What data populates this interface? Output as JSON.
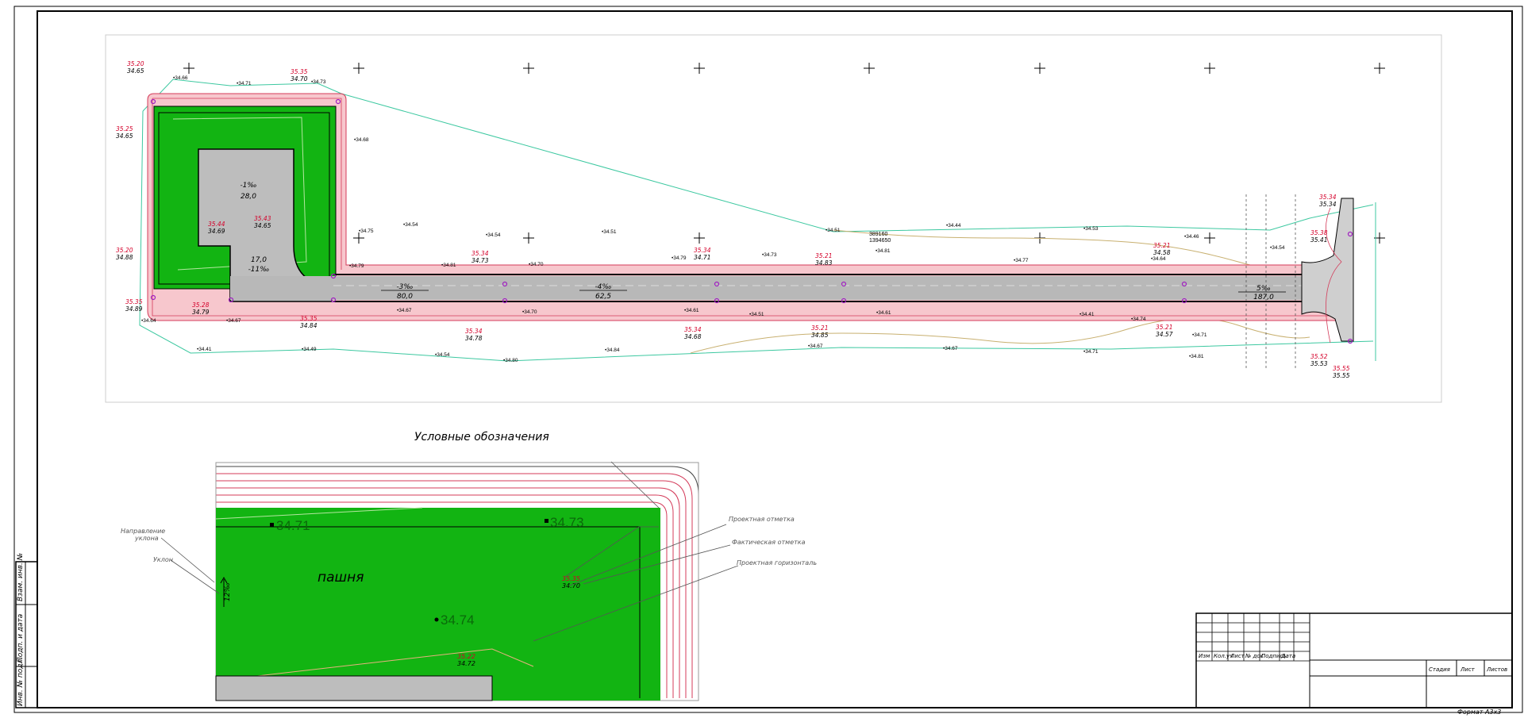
{
  "legend_title": "Условные обозначения",
  "legend": {
    "field_label": "пашня",
    "elev_1": "34.71",
    "elev_2": "34.73",
    "elev_3": "34.74",
    "slope_value": "12‰",
    "proj_mark_red": "35.35",
    "proj_mark_black": "34.70",
    "proj_mark2_red": "35.22",
    "proj_mark2_black": "34.72",
    "label_direction_1": "Направление",
    "label_direction_2": "уклона",
    "label_slope": "Уклон",
    "label_project_mark": "Проектная отметка",
    "label_actual_mark": "Фактическая отметка",
    "label_project_contour": "Проектная горизонталь"
  },
  "stamp": {
    "col_izm": "Изм",
    "col_koluch": "Кол.уч",
    "col_list": "Лист",
    "col_ndok": "№ док",
    "col_podpis": "Подпись",
    "col_data": "Дата",
    "col_stadiya": "Стадия",
    "col_list2": "Лист",
    "col_listov": "Листов",
    "format": "Формат А3х3"
  },
  "side_stamp": {
    "inv_podl": "Инв. № подл.",
    "podp_data": "Подп. и дата",
    "vzam_inv": "Взам. инв. №"
  },
  "plan": {
    "segment_1_slope": "-3‰",
    "segment_1_len": "80,0",
    "segment_2_slope": "-4‰",
    "segment_2_len": "62,5",
    "segment_3_slope": "5‰",
    "segment_3_len": "187,0",
    "pad_slope": "-1‰",
    "pad_len": "28,0",
    "pad_side_slope": "17,0",
    "pad_side_len": "-11‰",
    "coord_1": "389160",
    "coord_2": "1394650",
    "points": [
      {
        "red": "35.20",
        "black": "34.65"
      },
      {
        "red": "35.35",
        "black": "34.70"
      },
      {
        "red": "35.25",
        "black": "34.65"
      },
      {
        "red": "35.20",
        "black": "34.88"
      },
      {
        "red": "35.35",
        "black": "34.89"
      },
      {
        "red": "35.28",
        "black": "34.79"
      },
      {
        "red": "35.35",
        "black": "34.84"
      },
      {
        "red": "35.44",
        "black": "34.69"
      },
      {
        "red": "35.43",
        "black": "34.65"
      },
      {
        "red": "35.34",
        "black": "34.73"
      },
      {
        "red": "35.34",
        "black": "34.78"
      },
      {
        "red": "35.34",
        "black": "34.71"
      },
      {
        "red": "35.34",
        "black": "34.68"
      },
      {
        "red": "35.21",
        "black": "34.83"
      },
      {
        "red": "35.21",
        "black": "34.85"
      },
      {
        "red": "35.21",
        "black": "34.58"
      },
      {
        "red": "35.21",
        "black": "34.57"
      },
      {
        "red": "35.34",
        "black": "35.34"
      },
      {
        "red": "35.38",
        "black": "35.41"
      },
      {
        "red": "35.52",
        "black": "35.53"
      },
      {
        "red": "35.55",
        "black": "35.55"
      }
    ],
    "spot_elevations": [
      "34.66",
      "34.71",
      "34.73",
      "34.68",
      "34.75",
      "34.54",
      "34.54",
      "34.51",
      "34.51",
      "34.44",
      "34.53",
      "34.46",
      "34.79",
      "34.81",
      "34.70",
      "34.79",
      "34.73",
      "34.81",
      "34.77",
      "34.64",
      "34.67",
      "34.70",
      "34.61",
      "34.51",
      "34.61",
      "34.41",
      "34.41",
      "34.49",
      "34.54",
      "34.80",
      "34.84",
      "34.67",
      "34.67",
      "34.71",
      "34.67",
      "34.64",
      "34.81",
      "34.71",
      "34.74",
      "34.54"
    ]
  }
}
